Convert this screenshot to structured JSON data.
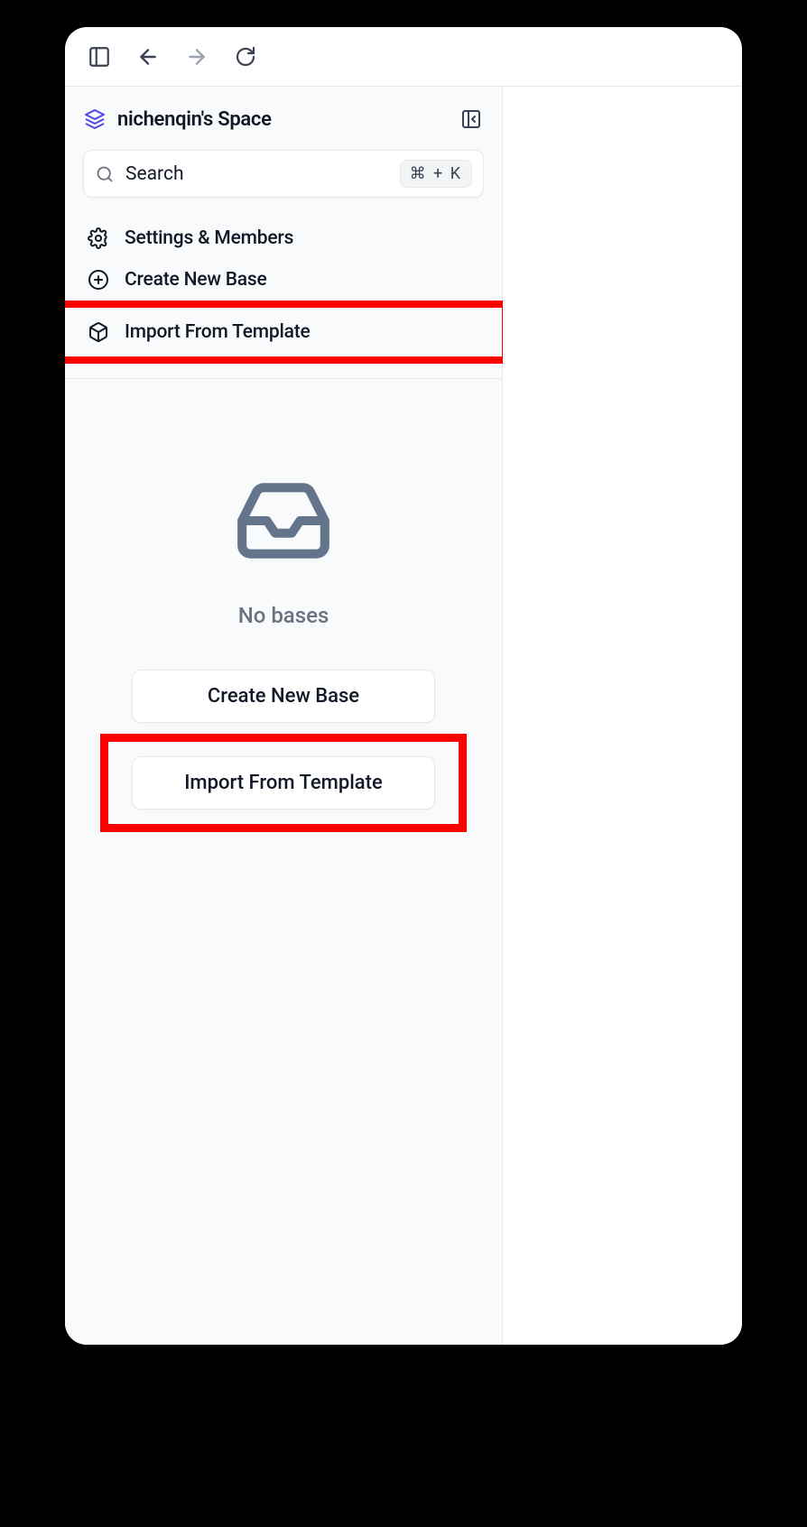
{
  "space": {
    "title": "nichenqin's Space"
  },
  "search": {
    "placeholder": "Search",
    "shortcut": "⌘ + K"
  },
  "menu": {
    "settings": "Settings & Members",
    "create_base": "Create New Base",
    "import_template": "Import From Template"
  },
  "empty": {
    "title": "No bases",
    "create_btn": "Create New Base",
    "import_btn": "Import From Template"
  }
}
